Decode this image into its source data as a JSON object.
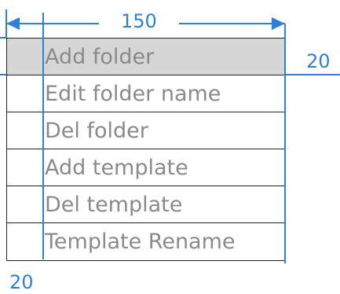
{
  "diagram": {
    "width_label": "150",
    "height_label": "20",
    "indent_label": "20",
    "colors": {
      "dimension": "#2f80d8",
      "border": "#222222",
      "text": "#8a8a8a",
      "highlight": "#d6d6d6"
    }
  },
  "menu": {
    "items": [
      {
        "label": "Add folder",
        "highlighted": true
      },
      {
        "label": "Edit folder name",
        "highlighted": false
      },
      {
        "label": "Del folder",
        "highlighted": false
      },
      {
        "label": "Add template",
        "highlighted": false
      },
      {
        "label": "Del template",
        "highlighted": false
      },
      {
        "label": "Template Rename",
        "highlighted": false
      }
    ]
  }
}
